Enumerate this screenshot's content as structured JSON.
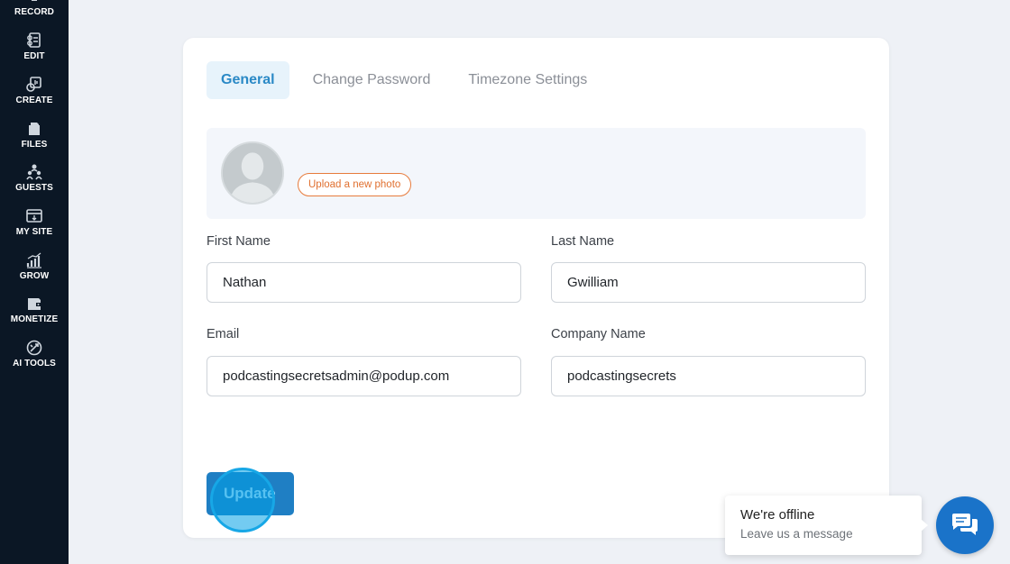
{
  "sidebar": {
    "items": [
      {
        "label": "RECORD",
        "icon": "record-icon"
      },
      {
        "label": "EDIT",
        "icon": "edit-icon"
      },
      {
        "label": "CREATE",
        "icon": "create-icon"
      },
      {
        "label": "FILES",
        "icon": "files-icon"
      },
      {
        "label": "GUESTS",
        "icon": "guests-icon"
      },
      {
        "label": "MY SITE",
        "icon": "my-site-icon"
      },
      {
        "label": "GROW",
        "icon": "grow-icon"
      },
      {
        "label": "MONETIZE",
        "icon": "monetize-icon"
      },
      {
        "label": "AI TOOLS",
        "icon": "ai-tools-icon"
      }
    ]
  },
  "tabs": {
    "general": "General",
    "change_password": "Change Password",
    "timezone": "Timezone Settings",
    "active": "General"
  },
  "photo": {
    "upload_label": "Upload a new photo"
  },
  "form": {
    "first_name": {
      "label": "First Name",
      "value": "Nathan"
    },
    "last_name": {
      "label": "Last Name",
      "value": "Gwilliam"
    },
    "email": {
      "label": "Email",
      "value": "podcastingsecretsadmin@podup.com"
    },
    "company": {
      "label": "Company Name",
      "value": "podcastingsecrets"
    },
    "update_label": "Update"
  },
  "chat": {
    "title": "We're offline",
    "subtitle": "Leave us a message"
  },
  "colors": {
    "sidebar_bg": "#0b1725",
    "accent": "#2a89c6",
    "update_button": "#1f7fc4",
    "upload_border": "#e77b3c",
    "chat_launcher": "#1a73c9"
  }
}
